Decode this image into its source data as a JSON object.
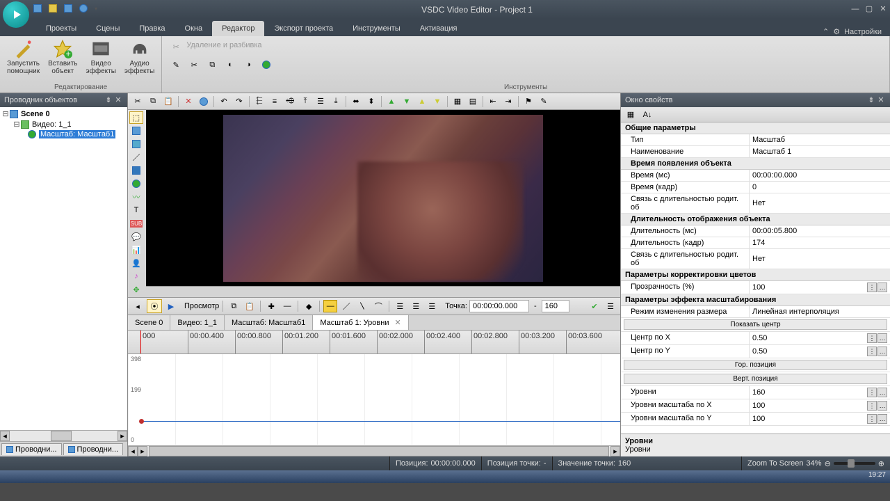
{
  "app": {
    "title": "VSDC Video Editor - Project 1"
  },
  "menu": {
    "tabs": [
      "Проекты",
      "Сцены",
      "Правка",
      "Окна",
      "Редактор",
      "Экспорт проекта",
      "Инструменты",
      "Активация"
    ],
    "active": 4,
    "settings": "Настройки"
  },
  "ribbon": {
    "group1": {
      "btn0": "Запустить\nпомощник",
      "btn1": "Вставить\nобъект",
      "btn2": "Видео\nэффекты",
      "btn3": "Аудио\nэффекты",
      "label": "Редактирование"
    },
    "group2": {
      "disabled_cmd": "Удаление и разбивка",
      "label": "Инструменты"
    }
  },
  "left": {
    "header": "Проводник объектов",
    "tree": {
      "n0": "Scene 0",
      "n1": "Видео: 1_1",
      "n2": "Масштаб: Масштаб1"
    },
    "tabs": {
      "t0": "Проводни...",
      "t1": "Проводни..."
    }
  },
  "timeline": {
    "preview_label": "Просмотр",
    "point_label": "Точка:",
    "point_time": "00:00:00.000",
    "point_val": "160",
    "tabs": {
      "t0": "Scene 0",
      "t1": "Видео: 1_1",
      "t2": "Масштаб: Масштаб1",
      "t3": "Масштаб 1: Уровни"
    },
    "ruler": [
      "000",
      "00:00.400",
      "00:00.800",
      "00:01.200",
      "00:01.600",
      "00:02.000",
      "00:02.400",
      "00:02.800",
      "00:03.200",
      "00:03.600"
    ],
    "ylabels": {
      "y0": "398",
      "y1": "199",
      "y2": "0"
    }
  },
  "props": {
    "header": "Окно свойств",
    "sections": {
      "s0": "Общие параметры",
      "s1": "Время появления объекта",
      "s2": "Длительность отображения объекта",
      "s3": "Параметры корректировки цветов",
      "s4": "Параметры эффекта масштабирования"
    },
    "rows": {
      "type_k": "Тип",
      "type_v": "Масштаб",
      "name_k": "Наименование",
      "name_v": "Масштаб 1",
      "time_ms_k": "Время (мс)",
      "time_ms_v": "00:00:00.000",
      "time_fr_k": "Время (кадр)",
      "time_fr_v": "0",
      "link1_k": "Связь с длительностью родит. об",
      "link1_v": "Нет",
      "dur_ms_k": "Длительность (мс)",
      "dur_ms_v": "00:00:05.800",
      "dur_fr_k": "Длительность (кадр)",
      "dur_fr_v": "174",
      "link2_k": "Связь с длительностью родит. об",
      "link2_v": "Нет",
      "opacity_k": "Прозрачность (%)",
      "opacity_v": "100",
      "resize_k": "Режим изменения размера",
      "resize_v": "Линейная интерполяция",
      "show_center": "Показать центр",
      "cx_k": "Центр по X",
      "cx_v": "0.50",
      "cy_k": "Центр по Y",
      "cy_v": "0.50",
      "hor_pos": "Гор. позиция",
      "vert_pos": "Верт. позиция",
      "levels_k": "Уровни",
      "levels_v": "160",
      "lx_k": "Уровни масштаба по X",
      "lx_v": "100",
      "ly_k": "Уровни масштаба по Y",
      "ly_v": "100"
    },
    "desc_title": "Уровни",
    "desc_text": "Уровни"
  },
  "status": {
    "pos_k": "Позиция:",
    "pos_v": "00:00:00.000",
    "ppt_k": "Позиция точки:",
    "ppt_v": "-",
    "val_k": "Значение точки:",
    "val_v": "160",
    "zoom_label": "Zoom To Screen",
    "zoom_pct": "34%"
  },
  "taskbar": {
    "clock": "19:27"
  }
}
